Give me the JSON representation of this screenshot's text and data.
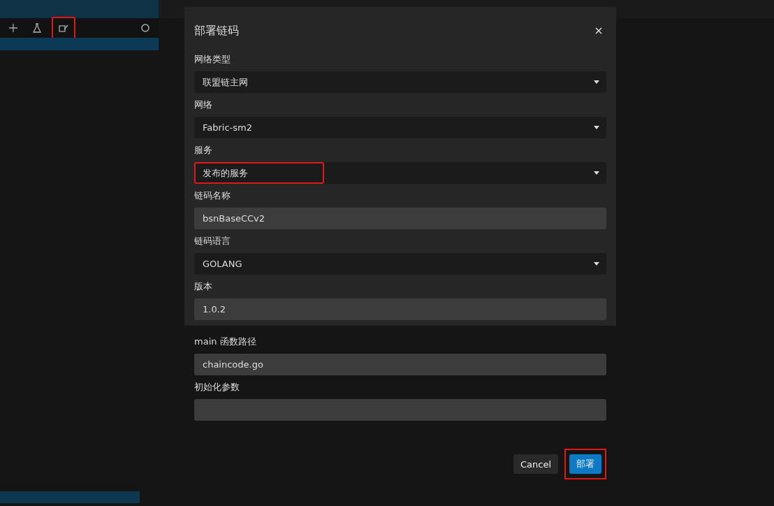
{
  "sidebar": {
    "toolbar": [
      {
        "kind": "add",
        "highlighted": false
      },
      {
        "kind": "flask",
        "highlighted": false
      },
      {
        "kind": "deploy",
        "highlighted": true
      },
      {
        "kind": "refresh",
        "highlighted": false
      }
    ]
  },
  "dialog": {
    "title": "部署链码",
    "fields": [
      {
        "label": "网络类型",
        "kind": "select",
        "value": "联盟链主网",
        "highlighted": false
      },
      {
        "label": "网络",
        "kind": "select",
        "value": "Fabric-sm2",
        "highlighted": false
      },
      {
        "label": "服务",
        "kind": "select",
        "value": "发布的服务",
        "highlighted": true
      },
      {
        "label": "链码名称",
        "kind": "input",
        "value": "bsnBaseCCv2",
        "highlighted": false
      },
      {
        "label": "链码语言",
        "kind": "select",
        "value": "GOLANG",
        "highlighted": false
      },
      {
        "label": "版本",
        "kind": "input",
        "value": "1.0.2",
        "highlighted": false
      },
      {
        "label": "main 函数路径",
        "kind": "input",
        "value": "chaincode.go",
        "highlighted": false
      },
      {
        "label": "初始化参数",
        "kind": "input",
        "highlighted": false
      }
    ],
    "buttons": [
      {
        "label": "Cancel",
        "kind": "secondary",
        "highlighted": false
      },
      {
        "label": "部署",
        "kind": "primary",
        "highlighted": true
      }
    ]
  }
}
